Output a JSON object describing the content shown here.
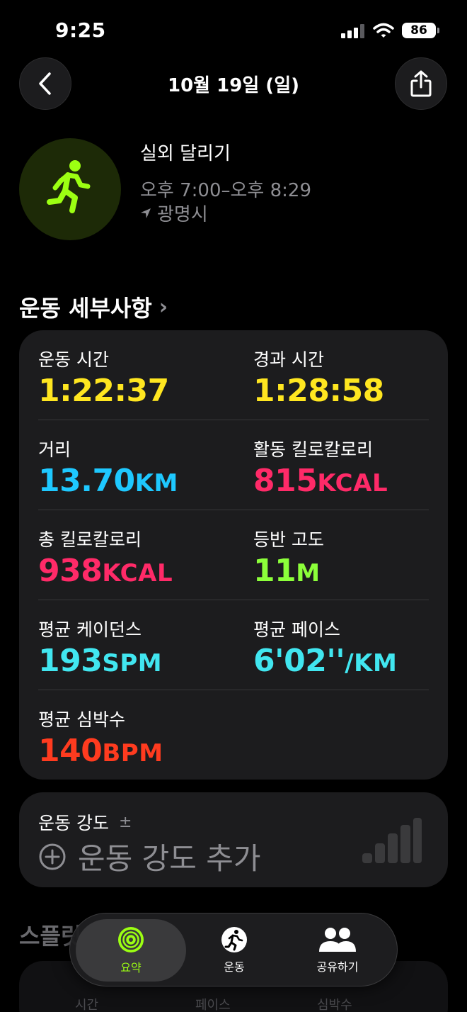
{
  "status_bar": {
    "time": "9:25",
    "battery": "86"
  },
  "nav": {
    "title": "10월 19일 (일)"
  },
  "workout": {
    "name": "실외 달리기",
    "time_range": "오후 7:00–오후 8:29",
    "location": "광명시",
    "accent_color": "#9cff12"
  },
  "details": {
    "section_title": "운동 세부사항",
    "metrics": [
      {
        "label": "운동 시간",
        "value": "1:22:37",
        "unit": "",
        "color": "#ffe620"
      },
      {
        "label": "경과 시간",
        "value": "1:28:58",
        "unit": "",
        "color": "#ffe620"
      },
      {
        "label": "거리",
        "value": "13.70",
        "unit": "KM",
        "color": "#1ec8ff"
      },
      {
        "label": "활동 킬로칼로리",
        "value": "815",
        "unit": "KCAL",
        "color": "#ff2a68"
      },
      {
        "label": "총 킬로칼로리",
        "value": "938",
        "unit": "KCAL",
        "color": "#ff2a68"
      },
      {
        "label": "등반 고도",
        "value": "11",
        "unit": "M",
        "color": "#8cff3a"
      },
      {
        "label": "평균 케이던스",
        "value": "193",
        "unit": "SPM",
        "color": "#41e6f0"
      },
      {
        "label": "평균 페이스",
        "value": "6'02''",
        "unit": "/KM",
        "color": "#41e6f0"
      },
      {
        "label": "평균 심박수",
        "value": "140",
        "unit": "BPM",
        "color": "#ff3b1f"
      }
    ]
  },
  "intensity": {
    "label": "운동 강도",
    "symbol": "±",
    "add_label": "운동 강도 추가"
  },
  "splits": {
    "title": "스플릿",
    "headers": [
      "시간",
      "페이스",
      "심박수"
    ]
  },
  "tabbar": {
    "tabs": [
      {
        "label": "요약",
        "icon": "activity-rings-icon",
        "active": true
      },
      {
        "label": "운동",
        "icon": "runner-icon",
        "active": false
      },
      {
        "label": "공유하기",
        "icon": "people-icon",
        "active": false
      }
    ]
  }
}
